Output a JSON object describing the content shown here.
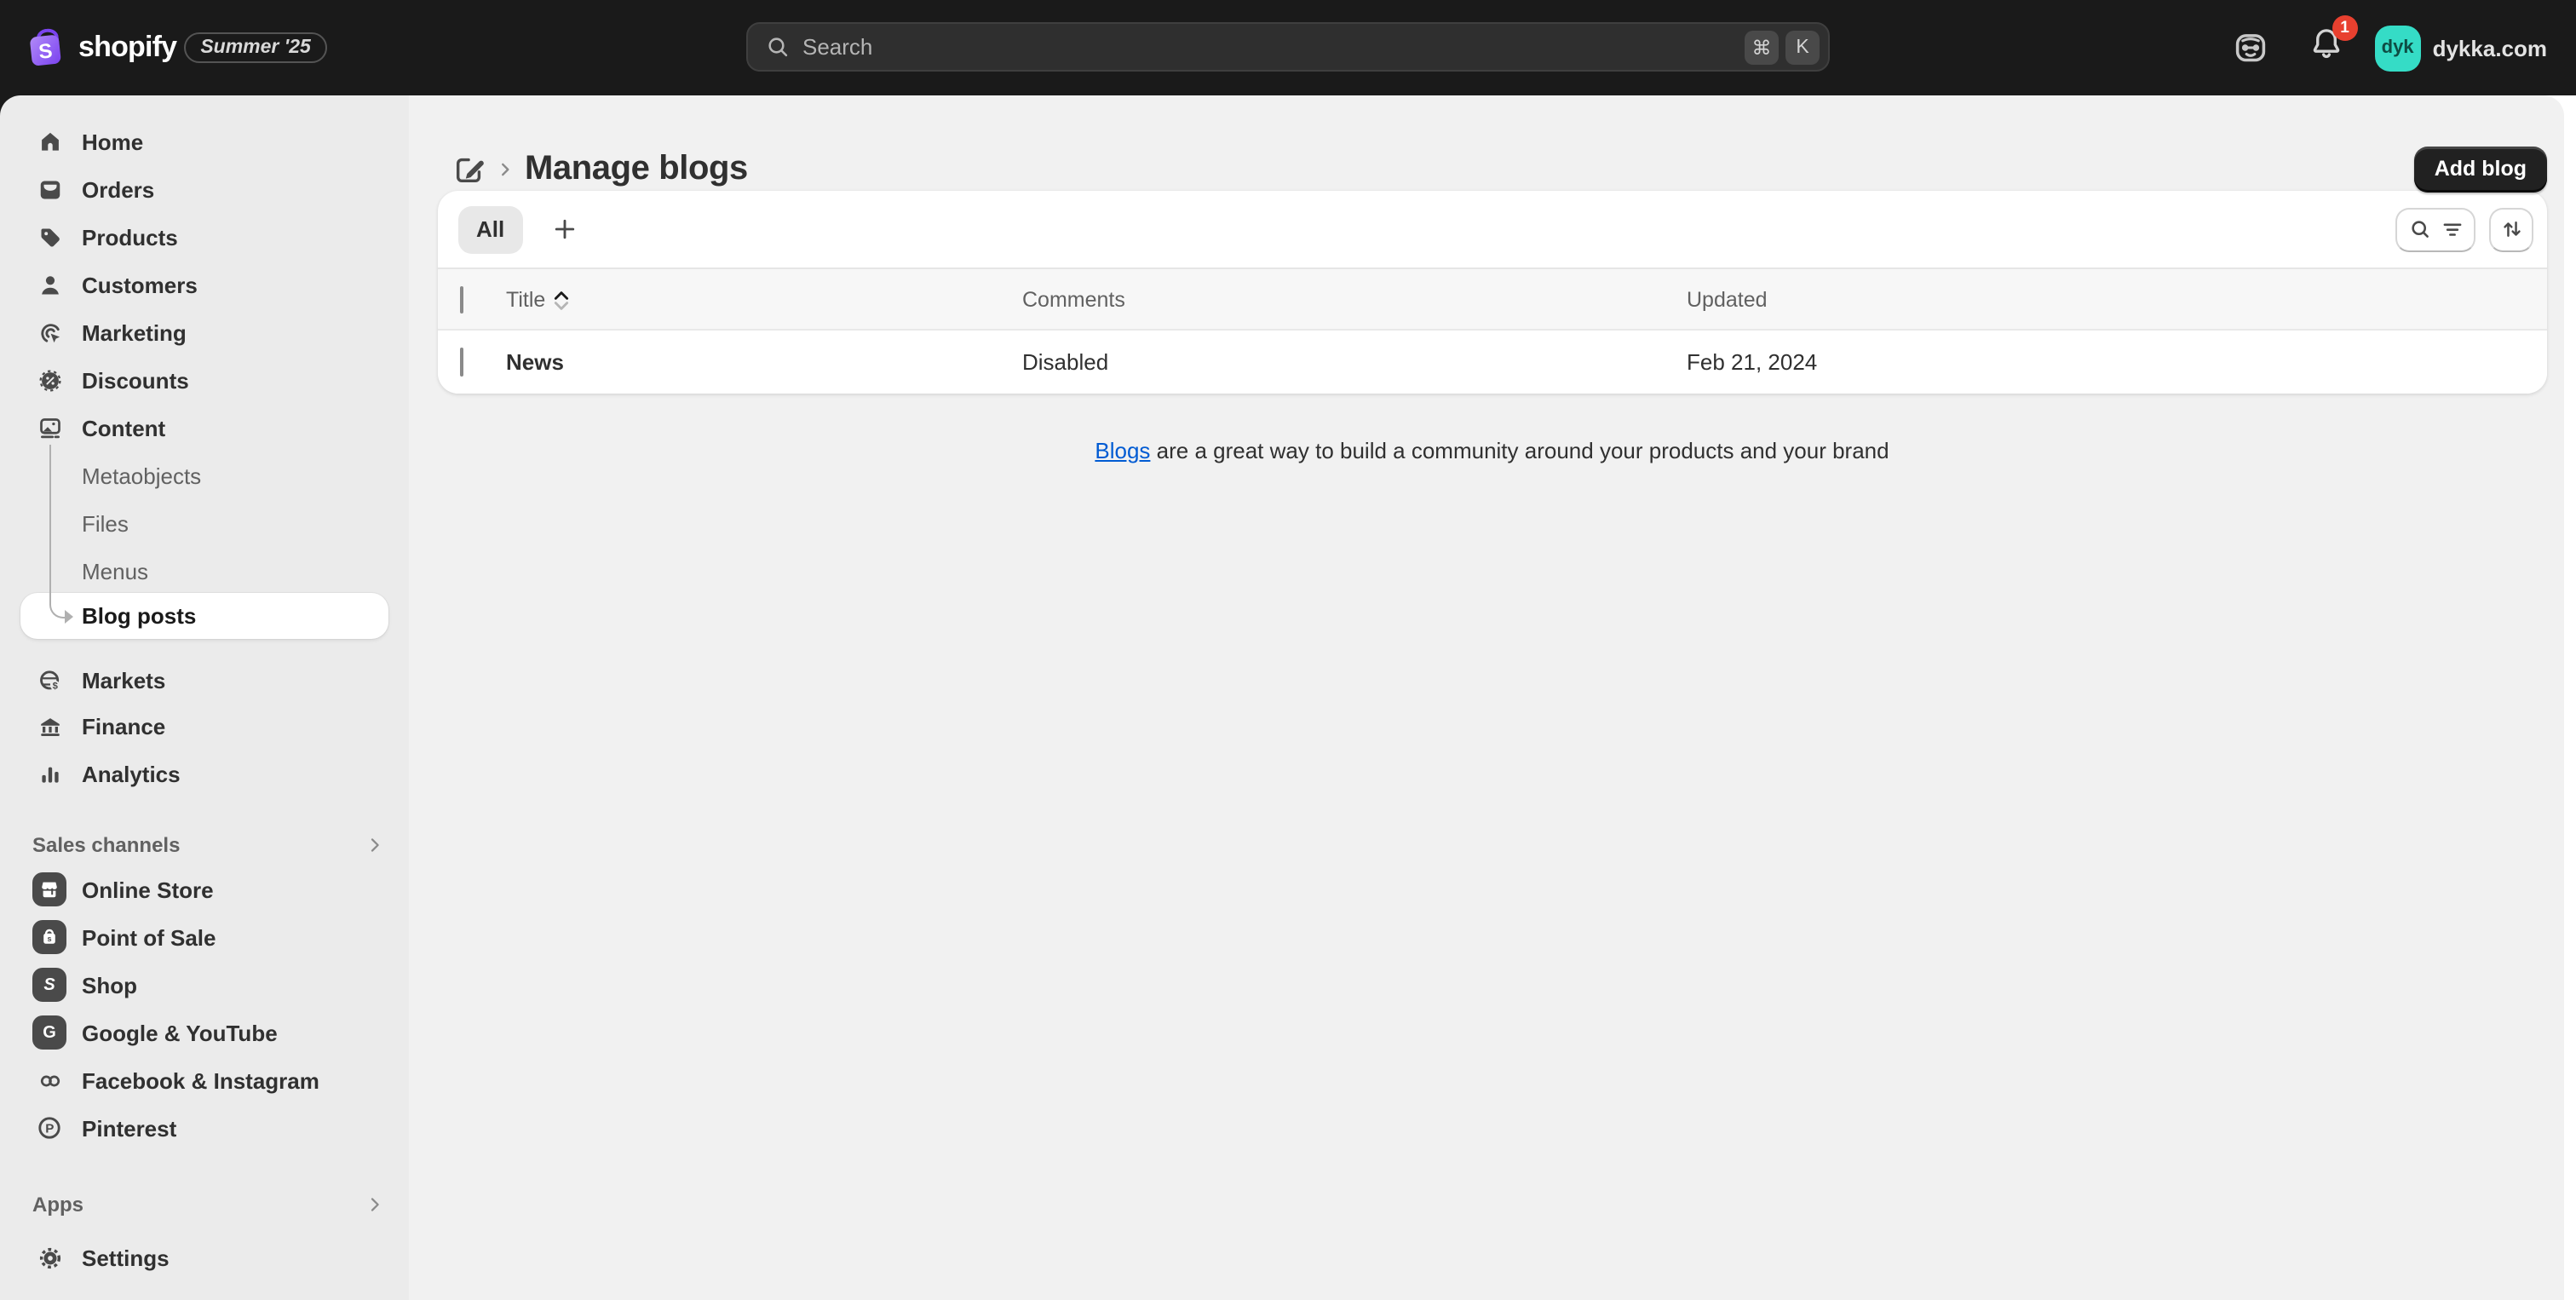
{
  "topbar": {
    "brand": "shopify",
    "release_badge": "Summer '25",
    "search_placeholder": "Search",
    "shortcut_mod": "⌘",
    "shortcut_key": "K",
    "notification_count": "1",
    "avatar_initials": "dyk",
    "store_domain": "dykka.com"
  },
  "sidebar": {
    "items": [
      "Home",
      "Orders",
      "Products",
      "Customers",
      "Marketing",
      "Discounts",
      "Content"
    ],
    "content_children": [
      "Metaobjects",
      "Files",
      "Menus",
      "Blog posts"
    ],
    "secondary_items": [
      "Markets",
      "Finance",
      "Analytics"
    ],
    "sales_channels": {
      "label": "Sales channels",
      "items": [
        "Online Store",
        "Point of Sale",
        "Shop",
        "Google & YouTube",
        "Facebook & Instagram",
        "Pinterest"
      ]
    },
    "apps_label": "Apps",
    "settings_label": "Settings"
  },
  "page": {
    "title": "Manage blogs",
    "primary_action": "Add blog",
    "tab_all": "All",
    "columns": {
      "title": "Title",
      "comments": "Comments",
      "updated": "Updated"
    },
    "rows": [
      {
        "title": "News",
        "comments": "Disabled",
        "updated": "Feb 21, 2024"
      }
    ],
    "footer_link": "Blogs",
    "footer_text": " are a great way to build a community around your products and your brand"
  },
  "colors": {
    "topbar_bg": "#1a1a1a",
    "sidebar_bg": "#ebebeb",
    "main_bg": "#f1f1f1",
    "link_blue": "#005bd3",
    "notification_red": "#e8402f",
    "avatar_teal": "#35dcc6",
    "brand_purple": "#9362f4"
  }
}
